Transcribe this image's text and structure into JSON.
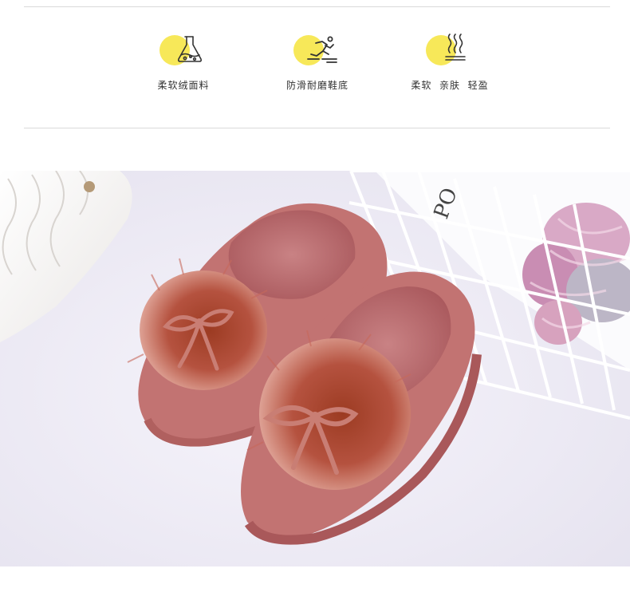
{
  "features": [
    {
      "icon": "flask-icon",
      "label": "柔软绒面料"
    },
    {
      "icon": "running-icon",
      "label": "防滑耐磨鞋底"
    },
    {
      "icon": "heat-waves-icon",
      "label": "柔软  亲肤  轻盈"
    }
  ],
  "photo": {
    "magazine_text": "PO",
    "colors": {
      "accent_yellow": "#f7e859",
      "slipper": "#c27372",
      "fur": "#b5523f"
    }
  }
}
